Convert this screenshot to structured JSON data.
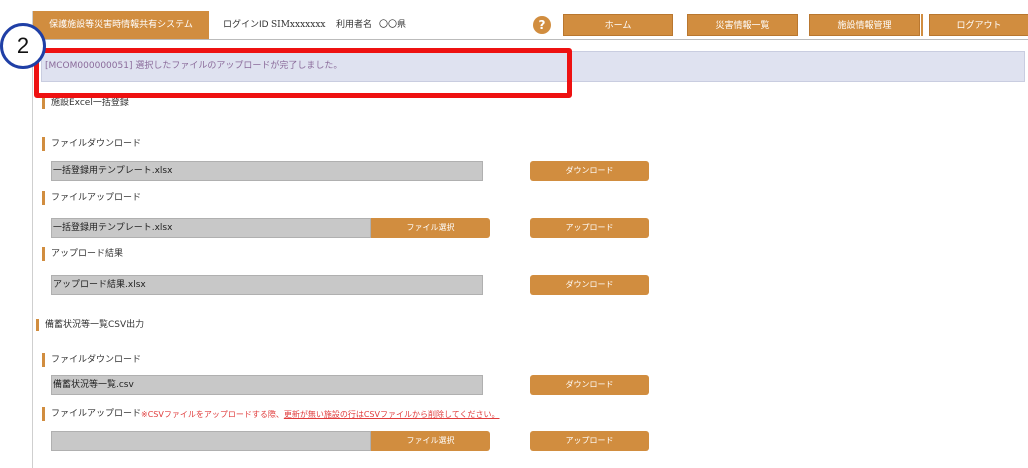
{
  "header": {
    "system_title": "保護施設等災害時情報共有システム",
    "login_label": "ログインID",
    "login_id": "SIMxxxxxxx",
    "user_label": "利用者名",
    "user_name": "〇〇県",
    "help_symbol": "?",
    "nav": {
      "home": "ホーム",
      "disaster_list": "災害情報一覧",
      "facility_mgmt": "施設情報管理",
      "logout": "ログアウト"
    }
  },
  "message": {
    "text": "[MCOM000000051] 選択したファイルのアップロードが完了しました。"
  },
  "step_badge": "2",
  "excel_section": {
    "title": "施設Excel一括登録",
    "download": {
      "label": "ファイルダウンロード",
      "file": "一括登録用テンプレート.xlsx",
      "button": "ダウンロード"
    },
    "upload": {
      "label": "ファイルアップロード",
      "file": "一括登録用テンプレート.xlsx",
      "select_button": "ファイル選択",
      "button": "アップロード"
    },
    "result": {
      "label": "アップロード結果",
      "file": "アップロード結果.xlsx",
      "button": "ダウンロード"
    }
  },
  "csv_section": {
    "title": "備蓄状況等一覧CSV出力",
    "download": {
      "label": "ファイルダウンロード",
      "file": "備蓄状況等一覧.csv",
      "button": "ダウンロード"
    },
    "upload": {
      "label": "ファイルアップロード",
      "note_prefix": "※CSVファイルをアップロードする際、",
      "note_link": "更新が無い施設の行はCSVファイルから削除してください。",
      "file": "",
      "select_button": "ファイル選択",
      "button": "アップロード"
    }
  },
  "colors": {
    "accent": "#d18d3f",
    "highlight": "#ee1111",
    "badge_border": "#1f3fa6",
    "message_bg": "#dfe2f0"
  }
}
